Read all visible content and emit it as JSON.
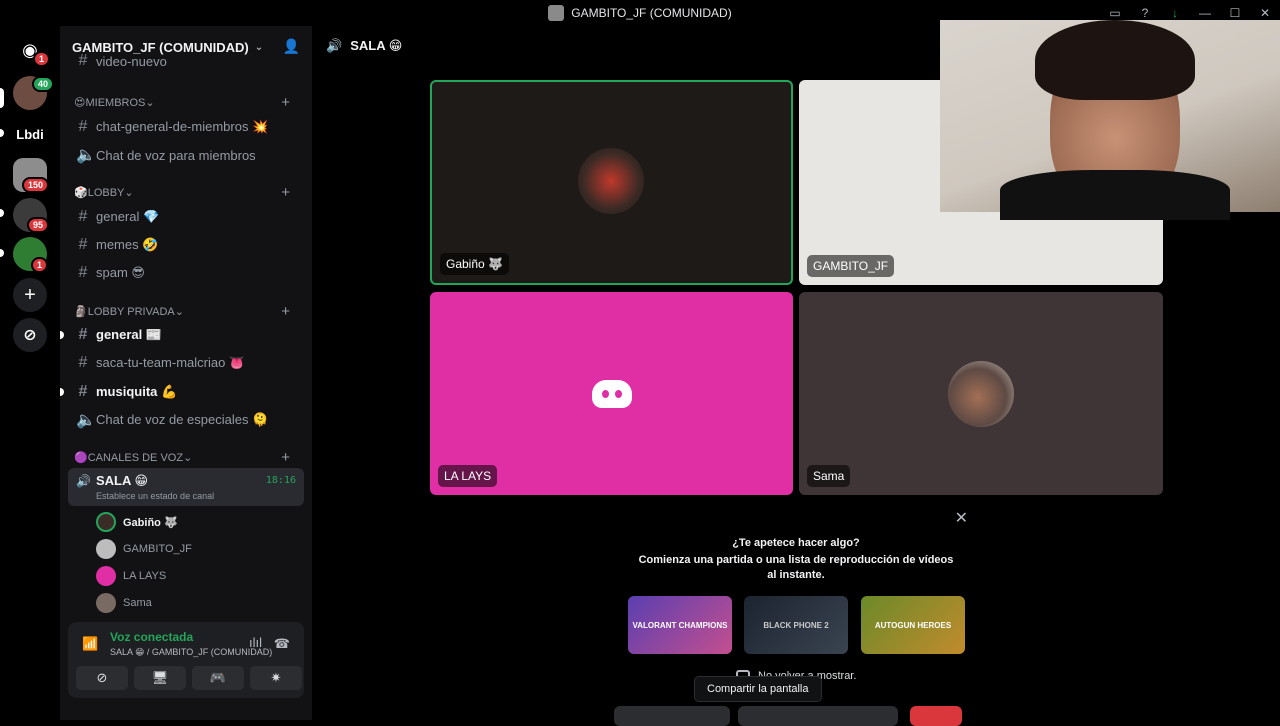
{
  "window": {
    "title": "GAMBITO_JF (COMUNIDAD)",
    "controls": [
      "—",
      "☐",
      "✕"
    ]
  },
  "servers": [
    {
      "label": "",
      "badge": "1",
      "color": "#5865f2"
    },
    {
      "label": "",
      "badge": "40",
      "color": "#6d4c41"
    },
    {
      "label": "Lbdi",
      "badge": "",
      "color": "#000000"
    },
    {
      "label": "",
      "badge": "150",
      "color": "#8d8d8d"
    },
    {
      "label": "",
      "badge": "95",
      "color": "#3b3b3b"
    },
    {
      "label": "",
      "badge": "1",
      "color": "#2e7d32"
    }
  ],
  "sidebar": {
    "guild_name": "GAMBITO_JF (COMUNIDAD)",
    "partial_channel": "video-nuevo",
    "categories": {
      "miembros": "MIEMBROS",
      "lobby": "LOBBY",
      "lobby_privada": "LOBBY PRIVADA",
      "voz": "CANALES DE VOZ"
    },
    "channels": {
      "chat_general": "chat-general-de-miembros 💥",
      "chat_voz_miembros": "Chat de voz para miembros",
      "general": "general 💎",
      "memes": "memes 🤣",
      "spam": "spam 😎",
      "general_priv": "general 📰",
      "saca_tu_team": "saca-tu-team-malcriao 👅",
      "musiquita": "musiquita 💪",
      "chat_voz_especiales": "Chat de voz de especiales 🫠"
    },
    "voice_channel": {
      "name": "SALA 😁",
      "time": "18:16",
      "status": "Establece un estado de canal"
    },
    "voice_users": [
      "Gabiño 🐺",
      "GAMBITO_JF",
      "LA LAYS",
      "Sama"
    ],
    "panel": {
      "connected": "Voz conectada",
      "location": "SALA 😁 / GAMBITO_JF (COMUNIDAD)"
    }
  },
  "main": {
    "channel_title": "SALA 😁",
    "tiles": [
      {
        "name": "Gabiño 🐺",
        "bg": "#1e1a17"
      },
      {
        "name": "GAMBITO_JF",
        "bg": "#e8e6e3"
      },
      {
        "name": "LA LAYS",
        "bg": "#e02fa4"
      },
      {
        "name": "Sama",
        "bg": "#3f3536"
      }
    ],
    "activity": {
      "heading": "¿Te apetece hacer algo?",
      "subheading": "Comienza una partida o una lista de reproducción de vídeos al instante.",
      "games": [
        "VALORANT CHAMPIONS",
        "BLACK PHONE 2",
        "AUTOGUN HEROES"
      ],
      "checkbox_label": "No volver a mostrar."
    },
    "tooltip": "Compartir la pantalla"
  },
  "colors": {
    "green": "#23a55a",
    "pink": "#e02fa4",
    "red": "#da373c"
  }
}
